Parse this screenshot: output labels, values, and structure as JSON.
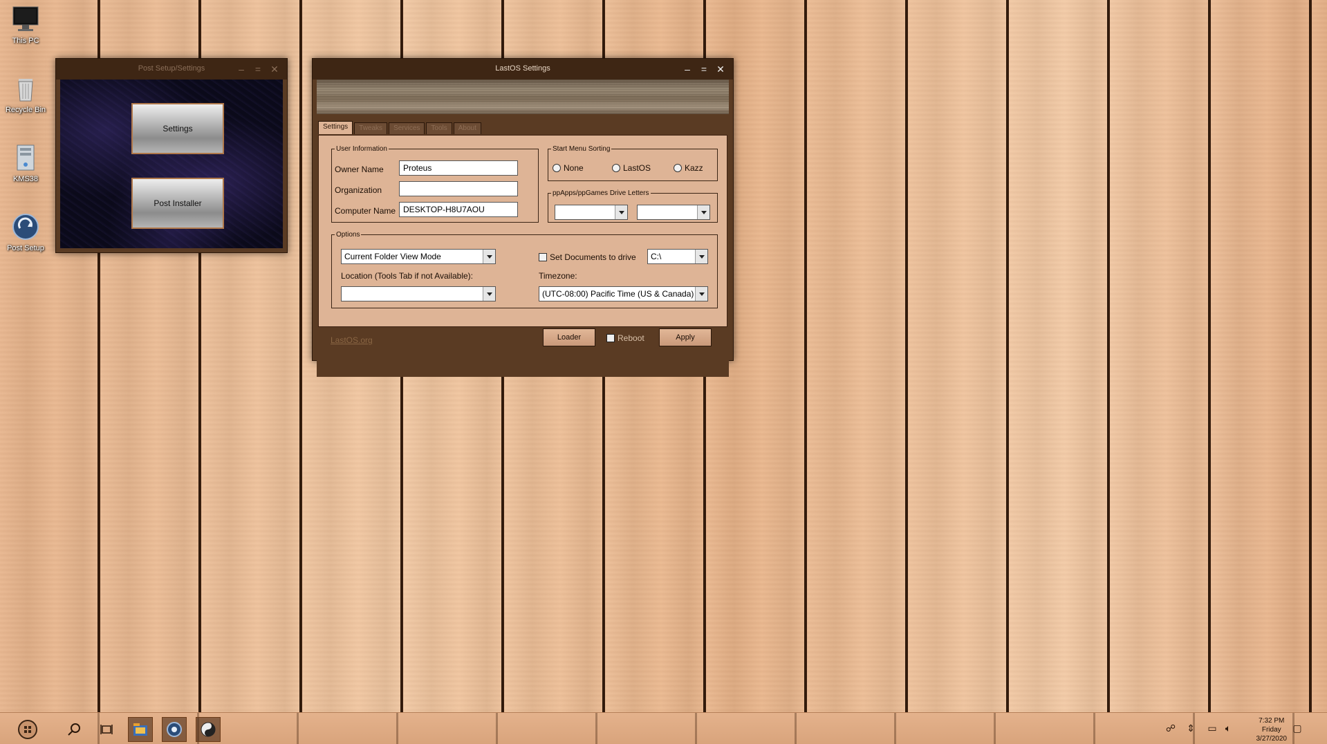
{
  "desktop": {
    "icons": [
      {
        "label": "This PC",
        "icon": "monitor-icon"
      },
      {
        "label": "Recycle Bin",
        "icon": "recycle-bin-icon"
      },
      {
        "label": "KMS38",
        "icon": "kms-icon"
      },
      {
        "label": "Post Setup",
        "icon": "post-setup-icon"
      }
    ]
  },
  "post_setup_window": {
    "title": "Post Setup/Settings",
    "settings_label": "Settings",
    "post_installer_label": "Post Installer"
  },
  "lastos_window": {
    "title": "LastOS Settings",
    "tabs": [
      "Settings",
      "Tweaks",
      "Services",
      "Tools",
      "About"
    ],
    "user_info": {
      "legend": "User Information",
      "owner_label": "Owner Name",
      "owner_value": "Proteus",
      "org_label": "Organization",
      "org_value": "",
      "computer_label": "Computer Name",
      "computer_value": "DESKTOP-H8U7AOU"
    },
    "start_menu": {
      "legend": "Start Menu Sorting",
      "options": [
        "None",
        "LastOS",
        "Kazz"
      ]
    },
    "drive_letters": {
      "legend": "ppApps/ppGames Drive Letters",
      "apps_value": "",
      "games_value": ""
    },
    "options": {
      "legend": "Options",
      "folder_view_value": "Current Folder View Mode",
      "set_docs_label": "Set Documents to drive",
      "docs_drive_value": "C:\\",
      "location_label": "Location (Tools Tab if not Available):",
      "location_value": "",
      "timezone_label": "Timezone:",
      "timezone_value": "(UTC-08:00) Pacific Time (US & Canada)"
    },
    "footer": {
      "link": "LastOS.org",
      "loader": "Loader",
      "reboot": "Reboot",
      "apply": "Apply"
    }
  },
  "taskbar": {
    "clock": {
      "time": "7:32 PM",
      "day": "Friday",
      "date": "3/27/2020"
    }
  },
  "colors": {
    "window_frame": "#5a3b23",
    "titlebar": "#3e2614",
    "content_bg": "#deb496"
  }
}
